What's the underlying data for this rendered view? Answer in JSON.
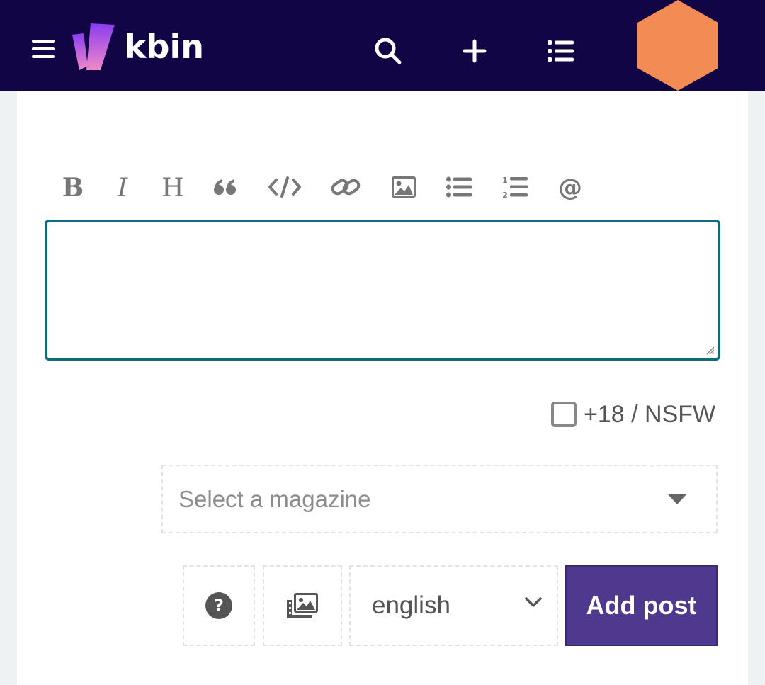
{
  "header": {
    "brand": "kbin",
    "icons": [
      "menu-icon",
      "kbin-logo",
      "search-icon",
      "plus-icon",
      "list-icon",
      "hexagon-avatar"
    ],
    "background": "#110545",
    "avatar_color": "#f28b54"
  },
  "editor": {
    "toolbar": [
      {
        "name": "bold-icon"
      },
      {
        "name": "italic-icon"
      },
      {
        "name": "heading-icon"
      },
      {
        "name": "quote-icon"
      },
      {
        "name": "code-icon"
      },
      {
        "name": "link-icon"
      },
      {
        "name": "image-icon"
      },
      {
        "name": "bullet-list-icon"
      },
      {
        "name": "numbered-list-icon"
      },
      {
        "name": "mention-icon"
      }
    ],
    "value": "",
    "border_color": "#0e6d78"
  },
  "nsfw": {
    "label": "+18 / NSFW",
    "checked": false
  },
  "magazine": {
    "placeholder": "Select a magazine"
  },
  "actions": {
    "language": "english",
    "submit_label": "Add post",
    "submit_color": "#4f398f"
  }
}
